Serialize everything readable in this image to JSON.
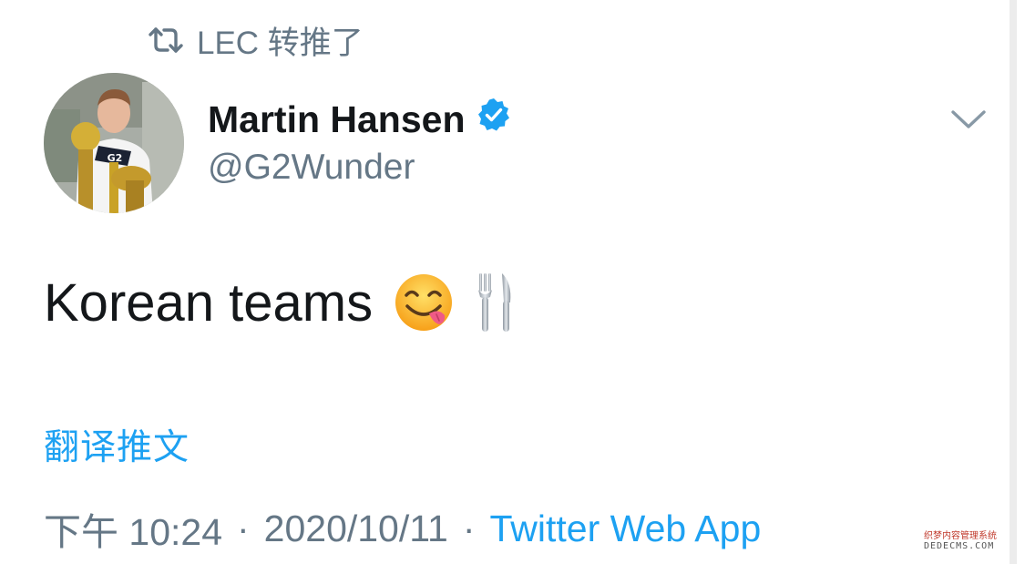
{
  "retweet": {
    "text": "LEC 转推了",
    "icon": "retweet-icon"
  },
  "author": {
    "name": "Martin Hansen",
    "handle": "@G2Wunder",
    "verified_icon": "verified-badge-icon",
    "avatar_icon": "avatar"
  },
  "menu": {
    "icon": "chevron-down-icon"
  },
  "tweet": {
    "text": "Korean teams",
    "emoji_1": "face-savoring-food-emoji",
    "emoji_2": "fork-and-knife-emoji"
  },
  "translate": {
    "label": "翻译推文"
  },
  "meta": {
    "time": "下午 10:24",
    "separator": "·",
    "date": "2020/10/11",
    "source": "Twitter Web App"
  },
  "watermark": {
    "line1": "织梦内容管理系统",
    "line2": "DEDECMS.COM"
  },
  "colors": {
    "accent": "#1da1f2",
    "text": "#14171a",
    "secondary": "#657786"
  }
}
